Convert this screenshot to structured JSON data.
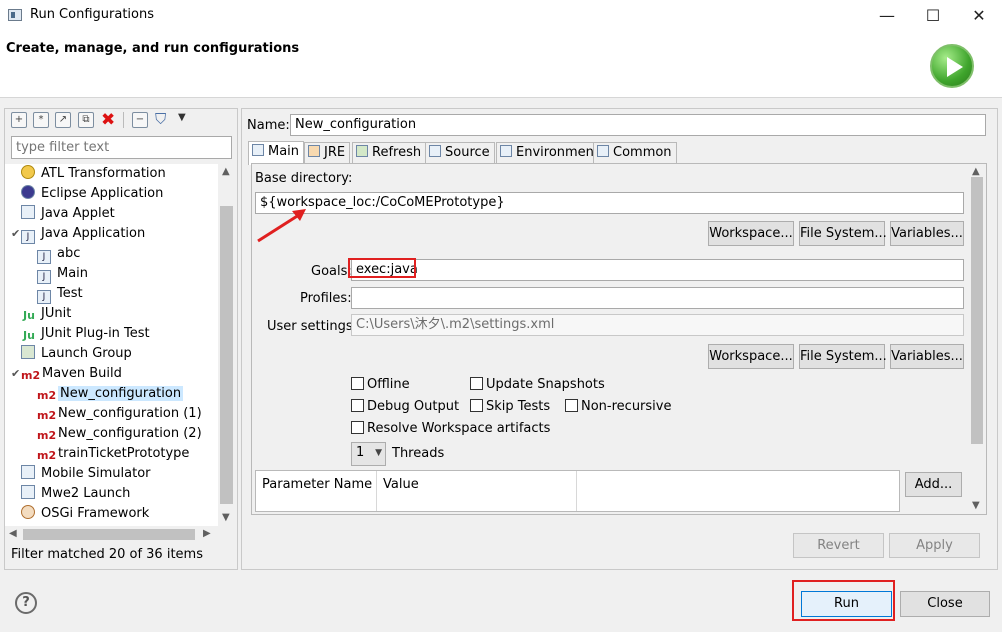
{
  "window": {
    "title": "Run Configurations",
    "minimize": "—",
    "maximize": "☐",
    "close": "✕"
  },
  "header": {
    "title": "Create, manage, and run configurations"
  },
  "left": {
    "filter_placeholder": "type filter text",
    "status": "Filter matched 20 of 36 items",
    "items": [
      {
        "label": "ATL Transformation",
        "icon": "atl-icon"
      },
      {
        "label": "Eclipse Application",
        "icon": "eclipse-icon"
      },
      {
        "label": "Java Applet",
        "icon": "java-applet-icon"
      },
      {
        "label": "Java Application",
        "icon": "java-app-icon"
      },
      {
        "label": "abc",
        "icon": "java-class-icon"
      },
      {
        "label": "Main",
        "icon": "java-class-icon"
      },
      {
        "label": "Test",
        "icon": "java-class-icon"
      },
      {
        "label": "JUnit",
        "icon": "junit-icon"
      },
      {
        "label": "JUnit Plug-in Test",
        "icon": "junit-plugin-icon"
      },
      {
        "label": "Launch Group",
        "icon": "launch-group-icon"
      },
      {
        "label": "Maven Build",
        "icon": "maven-icon"
      },
      {
        "label": "New_configuration",
        "icon": "maven-icon"
      },
      {
        "label": "New_configuration (1)",
        "icon": "maven-icon"
      },
      {
        "label": "New_configuration (2)",
        "icon": "maven-icon"
      },
      {
        "label": "trainTicketPrototype",
        "icon": "maven-icon"
      },
      {
        "label": "Mobile Simulator",
        "icon": "mobile-icon"
      },
      {
        "label": "Mwe2 Launch",
        "icon": "mwe2-icon"
      },
      {
        "label": "OSGi Framework",
        "icon": "osgi-icon"
      }
    ],
    "m2": "m2",
    "ju": "Ju"
  },
  "right": {
    "name_label": "Name:",
    "name_value": "New_configuration",
    "tabs": [
      "Main",
      "JRE",
      "Refresh",
      "Source",
      "Environment",
      "Common"
    ],
    "base_dir_label": "Base directory:",
    "base_dir_value": "${workspace_loc:/CoCoMEPrototype}",
    "workspace_btn": "Workspace...",
    "filesystem_btn": "File System...",
    "variables_btn": "Variables...",
    "goals_label": "Goals:",
    "goals_value": "exec:java",
    "profiles_label": "Profiles:",
    "profiles_value": "",
    "user_settings_label": "User settings:",
    "user_settings_value": "C:\\Users\\沐夕\\.m2\\settings.xml",
    "offline": "Offline",
    "update_snapshots": "Update Snapshots",
    "debug_output": "Debug Output",
    "skip_tests": "Skip Tests",
    "non_recursive": "Non-recursive",
    "resolve_ws": "Resolve Workspace artifacts",
    "threads_value": "1",
    "threads_label": "Threads",
    "param_col_name": "Parameter Name",
    "param_col_value": "Value",
    "add_btn": "Add...",
    "revert_btn": "Revert",
    "apply_btn": "Apply"
  },
  "footer": {
    "help": "?",
    "run_btn": "Run",
    "close_btn": "Close"
  },
  "colors": {
    "highlight": "#e02020",
    "selection": "#cce8ff",
    "run_green": "#3fa52c"
  }
}
